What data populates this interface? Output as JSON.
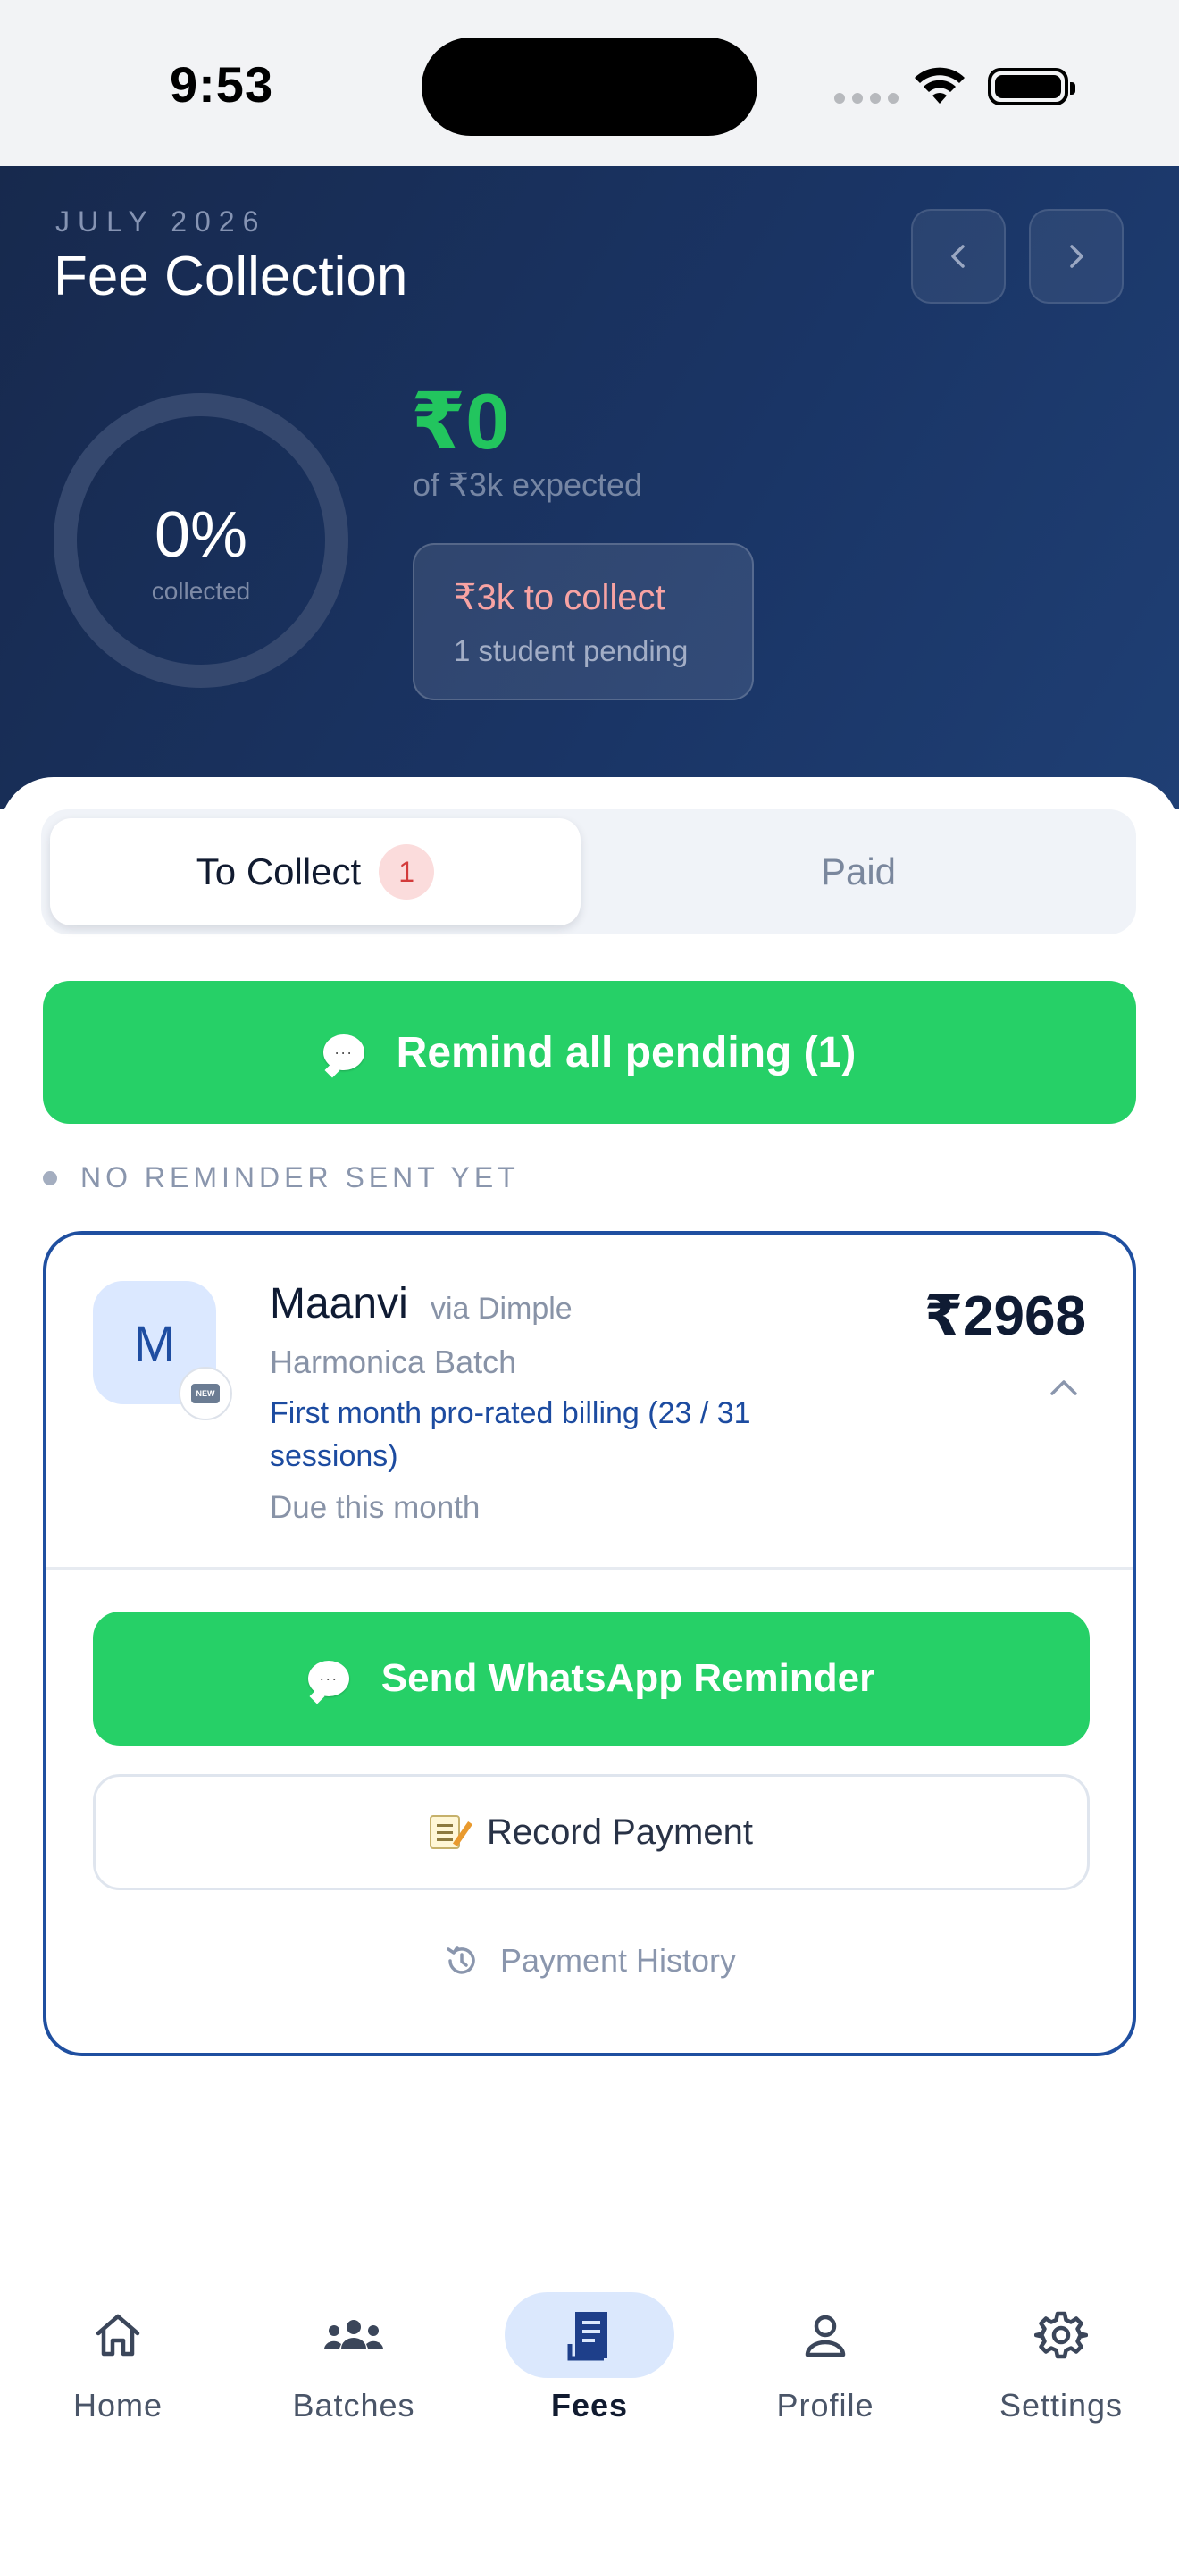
{
  "status_bar": {
    "time": "9:53"
  },
  "header": {
    "month": "JULY 2026",
    "title": "Fee Collection",
    "progress": {
      "percent_label": "0%",
      "percent_value": 0,
      "caption": "collected"
    },
    "collected_amount": "₹0",
    "expected_text": "of ₹3k expected",
    "pending_card": {
      "amount_text": "₹3k to collect",
      "subtext": "1 student pending"
    }
  },
  "tabs": {
    "to_collect": {
      "label": "To Collect",
      "badge": "1"
    },
    "paid": {
      "label": "Paid"
    }
  },
  "remind_all_button": {
    "label": "Remind all pending (1)",
    "icon": "speech-bubble-icon"
  },
  "reminder_status": "NO REMINDER SENT YET",
  "student_card": {
    "avatar_initial": "M",
    "new_badge": "NEW",
    "name": "Maanvi",
    "via": "via Dimple",
    "batch": "Harmonica Batch",
    "billing_note": "First month pro-rated billing (23 / 31 sessions)",
    "due": "Due this month",
    "amount": "₹2968",
    "whatsapp_button": "Send WhatsApp Reminder",
    "record_button": "Record Payment",
    "history_link": "Payment History"
  },
  "bottom_nav": [
    {
      "label": "Home",
      "icon": "home-icon"
    },
    {
      "label": "Batches",
      "icon": "group-icon"
    },
    {
      "label": "Fees",
      "icon": "receipt-icon"
    },
    {
      "label": "Profile",
      "icon": "person-icon"
    },
    {
      "label": "Settings",
      "icon": "gear-icon"
    }
  ],
  "colors": {
    "accent_green": "#26d067",
    "brand_blue": "#1f4fa0",
    "header_bg": "#17294d",
    "alert_red": "#f8a3a3"
  }
}
